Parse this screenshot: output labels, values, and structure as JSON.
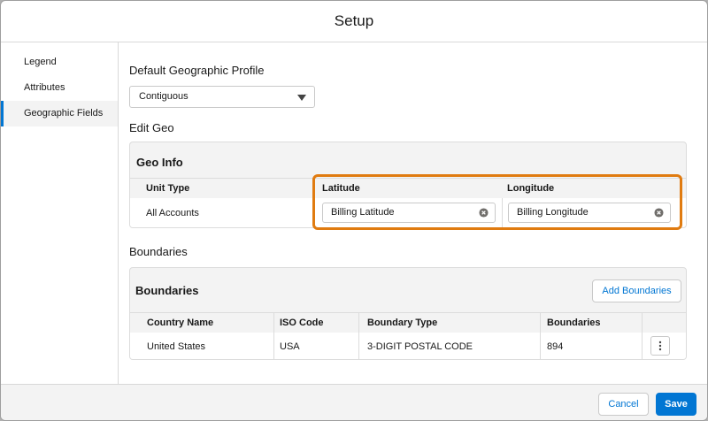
{
  "header": {
    "title": "Setup"
  },
  "sidebar": {
    "items": [
      {
        "label": "Legend"
      },
      {
        "label": "Attributes"
      },
      {
        "label": "Geographic Fields"
      }
    ]
  },
  "main": {
    "default_profile_label": "Default Geographic Profile",
    "profile_select_value": "Contiguous",
    "edit_geo_label": "Edit Geo",
    "geo_info": {
      "title": "Geo Info",
      "columns": [
        "Unit Type",
        "Latitude",
        "Longitude"
      ],
      "row": {
        "unit_type": "All Accounts",
        "latitude": "Billing Latitude",
        "longitude": "Billing Longitude"
      }
    },
    "boundaries_label": "Boundaries",
    "boundaries_card": {
      "title": "Boundaries",
      "add_button": "Add Boundaries",
      "columns": [
        "Country Name",
        "ISO Code",
        "Boundary Type",
        "Boundaries"
      ],
      "rows": [
        {
          "country": "United States",
          "iso": "USA",
          "type": "3-DIGIT POSTAL CODE",
          "count": "894"
        }
      ]
    }
  },
  "footer": {
    "cancel": "Cancel",
    "save": "Save"
  },
  "colors": {
    "brand": "#0176d3",
    "highlight": "#e07b10"
  }
}
